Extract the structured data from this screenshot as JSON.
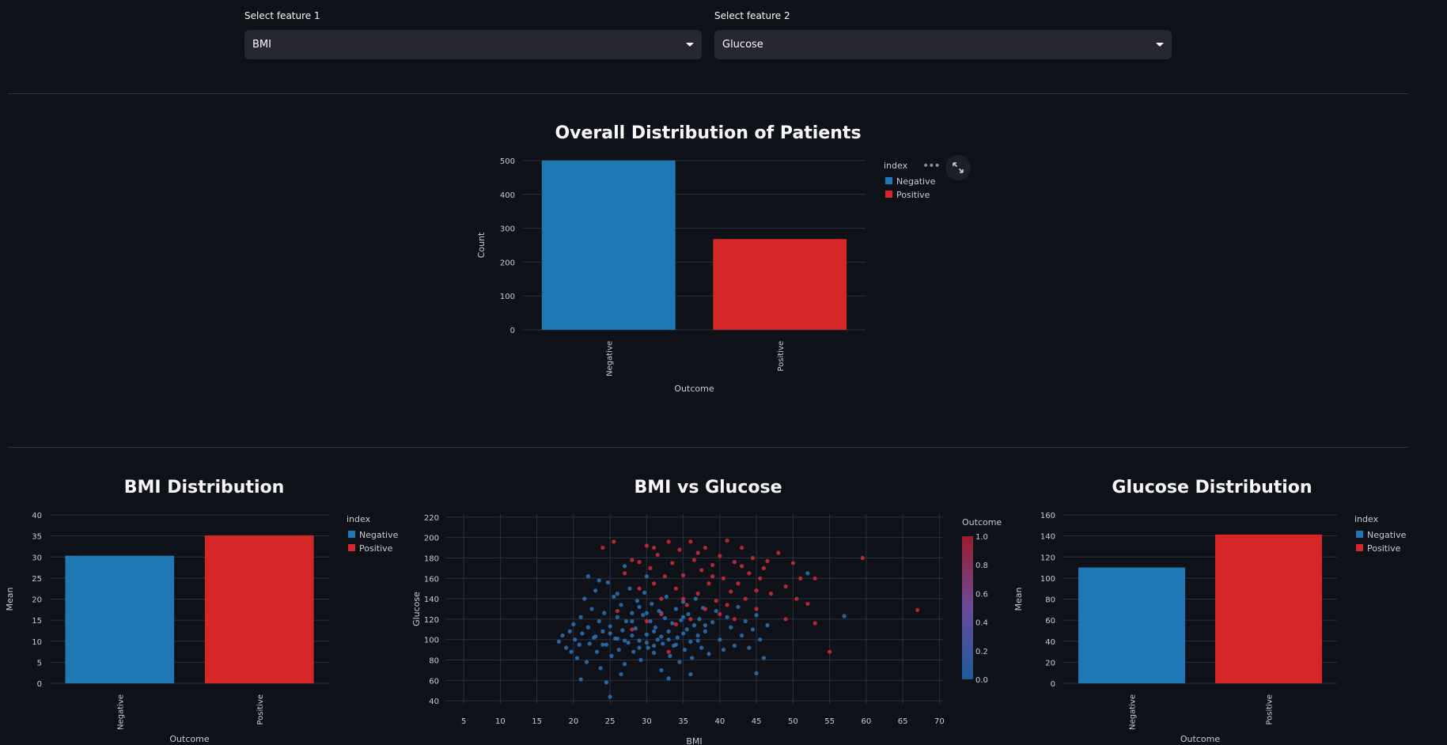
{
  "controls": {
    "feature1": {
      "label": "Select feature 1",
      "value": "BMI"
    },
    "feature2": {
      "label": "Select feature 2",
      "value": "Glucose"
    }
  },
  "toolbar": {
    "more_icon": "more-horizontal-icon",
    "fullscreen_icon": "fullscreen-icon"
  },
  "charts": {
    "overall": {
      "title": "Overall Distribution of Patients",
      "xlabel": "Outcome",
      "ylabel": "Count",
      "legend_title": "index"
    },
    "bmi": {
      "title": "BMI Distribution",
      "xlabel": "Outcome",
      "ylabel": "Mean",
      "legend_title": "index"
    },
    "scatter": {
      "title": "BMI vs Glucose",
      "xlabel": "BMI",
      "ylabel": "Glucose",
      "colorbar_title": "Outcome"
    },
    "glucose": {
      "title": "Glucose Distribution",
      "xlabel": "Outcome",
      "ylabel": "Mean",
      "legend_title": "index"
    }
  },
  "chart_data": [
    {
      "id": "overall",
      "type": "bar",
      "title": "Overall Distribution of Patients",
      "xlabel": "Outcome",
      "ylabel": "Count",
      "categories": [
        "Negative",
        "Positive"
      ],
      "values": [
        500,
        268
      ],
      "colors": [
        "#1f77b4",
        "#d62728"
      ],
      "ylim": [
        0,
        500
      ],
      "yticks": [
        0,
        100,
        200,
        300,
        400,
        500
      ],
      "legend": {
        "title": "index",
        "entries": [
          "Negative",
          "Positive"
        ],
        "placement": "right"
      },
      "grid": true
    },
    {
      "id": "bmi",
      "type": "bar",
      "title": "BMI Distribution",
      "xlabel": "Outcome",
      "ylabel": "Mean",
      "categories": [
        "Negative",
        "Positive"
      ],
      "values": [
        30.3,
        35.1
      ],
      "colors": [
        "#1f77b4",
        "#d62728"
      ],
      "ylim": [
        0,
        40
      ],
      "yticks": [
        0,
        5,
        10,
        15,
        20,
        25,
        30,
        35,
        40
      ],
      "legend": {
        "title": "index",
        "entries": [
          "Negative",
          "Positive"
        ],
        "placement": "right"
      },
      "grid": true
    },
    {
      "id": "scatter",
      "type": "scatter",
      "title": "BMI vs Glucose",
      "xlabel": "BMI",
      "ylabel": "Glucose",
      "xlim": [
        2.5,
        70.5
      ],
      "ylim": [
        37,
        223
      ],
      "xticks": [
        5,
        10,
        15,
        20,
        25,
        30,
        35,
        40,
        45,
        50,
        55,
        60,
        65,
        70
      ],
      "yticks": [
        40,
        60,
        80,
        100,
        120,
        140,
        160,
        180,
        200,
        220
      ],
      "colorbar": {
        "title": "Outcome",
        "ticks": [
          0.0,
          0.2,
          0.4,
          0.6,
          0.8,
          1.0
        ],
        "labels": [
          "0.0",
          "0.2",
          "0.4",
          "0.6",
          "0.8",
          "1.0"
        ],
        "range": [
          0,
          1
        ],
        "low_color": "#1f5a9a",
        "high_color": "#9b1b30"
      },
      "grid": true,
      "points": [
        [
          18,
          98,
          0
        ],
        [
          18.5,
          104,
          0
        ],
        [
          19,
          92,
          0
        ],
        [
          19.5,
          108,
          0
        ],
        [
          19.7,
          88,
          0
        ],
        [
          20,
          115,
          0
        ],
        [
          20.2,
          100,
          0
        ],
        [
          20.5,
          82,
          0
        ],
        [
          20.8,
          95,
          0
        ],
        [
          21,
          122,
          0
        ],
        [
          21.2,
          106,
          0
        ],
        [
          21.5,
          140,
          0
        ],
        [
          21.8,
          78,
          0
        ],
        [
          22,
          112,
          0
        ],
        [
          22.2,
          96,
          0
        ],
        [
          22.5,
          130,
          0
        ],
        [
          22.8,
          102,
          0
        ],
        [
          23,
          148,
          0
        ],
        [
          23.2,
          88,
          0
        ],
        [
          23.5,
          118,
          0
        ],
        [
          23.7,
          72,
          0
        ],
        [
          24,
          108,
          0
        ],
        [
          24.2,
          126,
          0
        ],
        [
          24.5,
          95,
          0
        ],
        [
          24.7,
          156,
          0
        ],
        [
          25,
          113,
          0
        ],
        [
          25.2,
          84,
          0
        ],
        [
          25.5,
          142,
          0
        ],
        [
          25.7,
          101,
          0
        ],
        [
          26,
          122,
          0
        ],
        [
          26.2,
          90,
          0
        ],
        [
          26.5,
          134,
          0
        ],
        [
          26.7,
          109,
          0
        ],
        [
          27,
          76,
          0
        ],
        [
          27.2,
          118,
          0
        ],
        [
          27.5,
          97,
          0
        ],
        [
          27.7,
          150,
          0
        ],
        [
          28,
          126,
          0
        ],
        [
          28.2,
          88,
          0
        ],
        [
          28.5,
          111,
          0
        ],
        [
          28.7,
          138,
          0
        ],
        [
          29,
          99,
          0
        ],
        [
          29.2,
          80,
          0
        ],
        [
          29.5,
          124,
          0
        ],
        [
          29.7,
          146,
          0
        ],
        [
          30,
          105,
          0
        ],
        [
          30.2,
          92,
          0
        ],
        [
          30.5,
          118,
          0
        ],
        [
          30.7,
          135,
          0
        ],
        [
          31,
          87,
          0
        ],
        [
          31.2,
          112,
          0
        ],
        [
          31.5,
          100,
          0
        ],
        [
          31.7,
          128,
          0
        ],
        [
          32,
          70,
          0
        ],
        [
          32.2,
          96,
          0
        ],
        [
          32.5,
          121,
          0
        ],
        [
          32.7,
          142,
          0
        ],
        [
          33,
          108,
          0
        ],
        [
          33.2,
          84,
          0
        ],
        [
          33.5,
          116,
          0
        ],
        [
          33.7,
          94,
          0
        ],
        [
          34,
          130,
          0
        ],
        [
          34.2,
          102,
          0
        ],
        [
          34.5,
          78,
          0
        ],
        [
          34.7,
          119,
          0
        ],
        [
          35,
          137,
          0
        ],
        [
          35.2,
          90,
          0
        ],
        [
          35.5,
          110,
          0
        ],
        [
          35.7,
          125,
          0
        ],
        [
          36,
          98,
          0
        ],
        [
          36.2,
          82,
          0
        ],
        [
          36.5,
          114,
          0
        ],
        [
          36.7,
          140,
          0
        ],
        [
          37,
          104,
          0
        ],
        [
          37.2,
          120,
          0
        ],
        [
          37.5,
          92,
          0
        ],
        [
          37.7,
          131,
          0
        ],
        [
          38,
          108,
          0
        ],
        [
          38.5,
          86,
          0
        ],
        [
          39,
          117,
          0
        ],
        [
          39.5,
          128,
          0
        ],
        [
          40,
          100,
          0
        ],
        [
          40.5,
          90,
          0
        ],
        [
          41,
          122,
          0
        ],
        [
          41.5,
          112,
          0
        ],
        [
          42,
          94,
          0
        ],
        [
          42.5,
          132,
          0
        ],
        [
          43,
          104,
          0
        ],
        [
          43.5,
          118,
          0
        ],
        [
          44,
          92,
          0
        ],
        [
          44.5,
          110,
          0
        ],
        [
          45,
          124,
          0
        ],
        [
          45.5,
          100,
          0
        ],
        [
          46,
          82,
          0
        ],
        [
          46.5,
          114,
          0
        ],
        [
          52,
          165,
          0
        ],
        [
          57,
          123,
          0
        ],
        [
          25,
          44,
          0
        ],
        [
          24.5,
          58,
          0
        ],
        [
          33,
          62,
          0
        ],
        [
          36,
          66,
          0
        ],
        [
          45,
          67,
          0
        ],
        [
          21,
          61,
          0
        ],
        [
          26.5,
          66,
          0
        ],
        [
          23.5,
          158,
          0
        ],
        [
          27,
          172,
          0
        ],
        [
          30,
          162,
          0
        ],
        [
          22,
          162,
          0
        ],
        [
          26,
          145,
          0
        ],
        [
          29,
          132,
          0
        ],
        [
          24,
          95,
          0
        ],
        [
          26,
          101,
          0
        ],
        [
          28,
          104,
          0
        ],
        [
          30,
          97,
          0
        ],
        [
          32,
          103,
          0
        ],
        [
          34,
          95,
          0
        ],
        [
          23,
          103,
          0
        ],
        [
          25,
          106,
          0
        ],
        [
          27,
          99,
          0
        ],
        [
          31,
          108,
          0
        ],
        [
          33,
          100,
          0
        ],
        [
          35,
          106,
          0
        ],
        [
          37,
          99,
          0
        ],
        [
          29,
          92,
          0
        ],
        [
          31,
          94,
          0
        ],
        [
          35,
          122,
          0
        ],
        [
          38,
          114,
          0
        ],
        [
          32,
          126,
          0
        ],
        [
          28,
          118,
          0
        ],
        [
          30,
          126,
          0
        ],
        [
          26,
          128,
          1
        ],
        [
          27,
          165,
          1
        ],
        [
          28,
          178,
          1
        ],
        [
          29,
          150,
          1
        ],
        [
          30,
          192,
          1
        ],
        [
          30.5,
          170,
          1
        ],
        [
          31,
          155,
          1
        ],
        [
          31.5,
          183,
          1
        ],
        [
          32,
          140,
          1
        ],
        [
          32.5,
          162,
          1
        ],
        [
          33,
          196,
          1
        ],
        [
          33.5,
          175,
          1
        ],
        [
          34,
          150,
          1
        ],
        [
          34.5,
          188,
          1
        ],
        [
          35,
          163,
          1
        ],
        [
          35.5,
          134,
          1
        ],
        [
          36,
          196,
          1
        ],
        [
          36.5,
          178,
          1
        ],
        [
          37,
          145,
          1
        ],
        [
          37.5,
          168,
          1
        ],
        [
          38,
          190,
          1
        ],
        [
          38.5,
          155,
          1
        ],
        [
          39,
          173,
          1
        ],
        [
          39.5,
          138,
          1
        ],
        [
          40,
          182,
          1
        ],
        [
          40.5,
          160,
          1
        ],
        [
          41,
          197,
          1
        ],
        [
          41.5,
          147,
          1
        ],
        [
          42,
          176,
          1
        ],
        [
          42.5,
          155,
          1
        ],
        [
          43,
          190,
          1
        ],
        [
          43.5,
          140,
          1
        ],
        [
          44,
          165,
          1
        ],
        [
          44.5,
          180,
          1
        ],
        [
          45,
          148,
          1
        ],
        [
          45.5,
          160,
          1
        ],
        [
          46,
          170,
          1
        ],
        [
          47,
          145,
          1
        ],
        [
          48,
          185,
          1
        ],
        [
          49,
          152,
          1
        ],
        [
          50,
          175,
          1
        ],
        [
          50.5,
          140,
          1
        ],
        [
          51,
          160,
          1
        ],
        [
          52,
          135,
          1
        ],
        [
          53,
          160,
          1
        ],
        [
          53,
          116,
          1
        ],
        [
          55,
          88,
          1
        ],
        [
          59.5,
          180,
          1
        ],
        [
          67,
          129,
          1
        ],
        [
          24,
          190,
          1
        ],
        [
          25.5,
          196,
          1
        ],
        [
          28,
          110,
          1
        ],
        [
          30,
          118,
          1
        ],
        [
          32,
          125,
          1
        ],
        [
          34,
          115,
          1
        ],
        [
          36,
          120,
          1
        ],
        [
          38,
          130,
          1
        ],
        [
          40,
          125,
          1
        ],
        [
          42,
          120,
          1
        ],
        [
          33,
          88,
          1
        ],
        [
          29,
          176,
          1
        ],
        [
          31,
          190,
          1
        ],
        [
          35,
          140,
          1
        ],
        [
          37,
          185,
          1
        ],
        [
          39,
          162,
          1
        ],
        [
          41,
          134,
          1
        ],
        [
          43,
          172,
          1
        ],
        [
          45,
          130,
          1
        ],
        [
          49,
          120,
          1
        ],
        [
          46.5,
          177,
          1
        ]
      ]
    },
    {
      "id": "glucose",
      "type": "bar",
      "title": "Glucose Distribution",
      "xlabel": "Outcome",
      "ylabel": "Mean",
      "categories": [
        "Negative",
        "Positive"
      ],
      "values": [
        110,
        141.3
      ],
      "colors": [
        "#1f77b4",
        "#d62728"
      ],
      "ylim": [
        0,
        160
      ],
      "yticks": [
        0,
        20,
        40,
        60,
        80,
        100,
        120,
        140,
        160
      ],
      "legend": {
        "title": "index",
        "entries": [
          "Negative",
          "Positive"
        ],
        "placement": "right"
      },
      "grid": true
    }
  ]
}
